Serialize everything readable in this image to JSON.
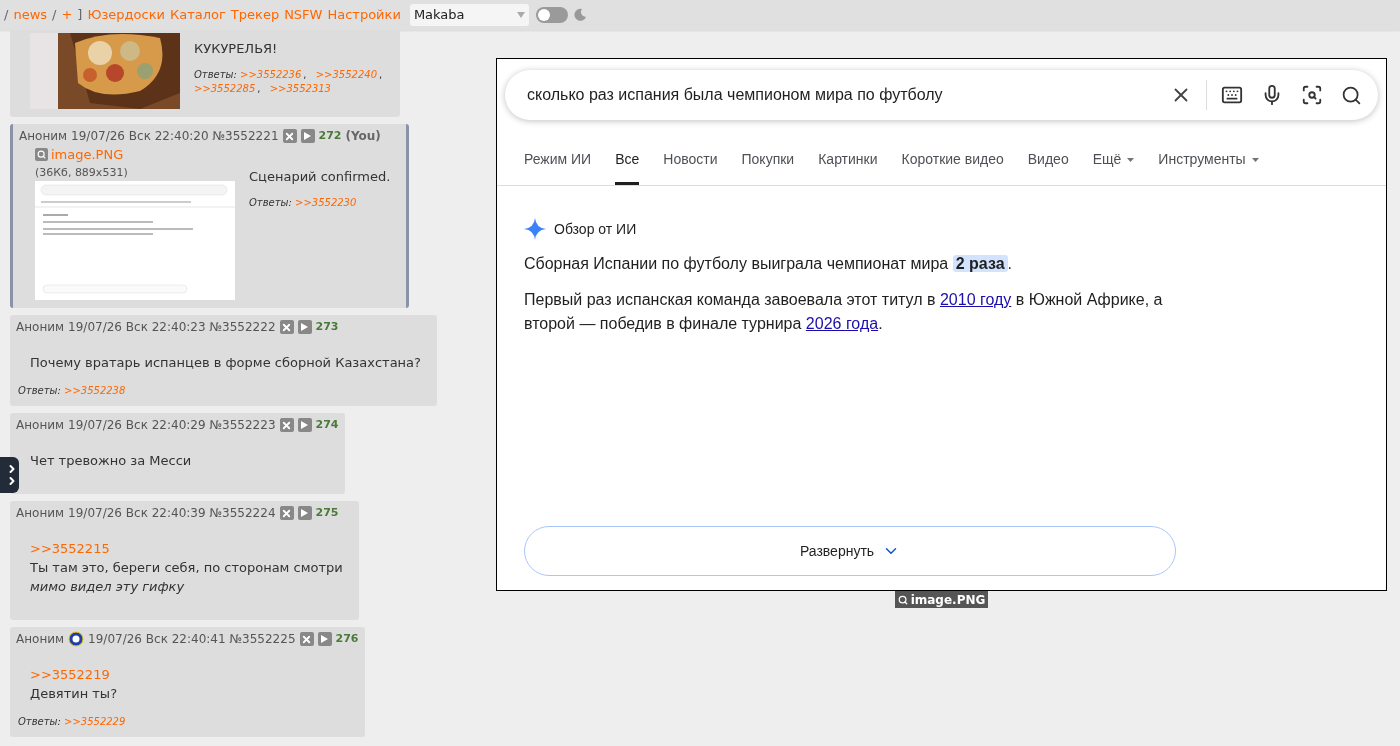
{
  "top_bar": {
    "nav": [
      {
        "kind": "sep",
        "text": "/"
      },
      {
        "kind": "link",
        "text": "news"
      },
      {
        "kind": "sep",
        "text": "/"
      },
      {
        "kind": "link",
        "text": "+"
      },
      {
        "kind": "sep",
        "text": "]"
      },
      {
        "kind": "link",
        "text": "Юзердоски"
      },
      {
        "kind": "link",
        "text": "Каталог"
      },
      {
        "kind": "link",
        "text": "Трекер"
      },
      {
        "kind": "link",
        "text": "NSFW"
      },
      {
        "kind": "link",
        "text": "Настройки"
      }
    ],
    "style_select": {
      "value": "Makaba"
    },
    "dark_mode": {
      "on": false
    }
  },
  "posts": [
    {
      "picture": {
        "kind": "picture"
      },
      "lines": [
        {
          "kind": "text",
          "text": "КУКУРЕЛЬЯ!"
        }
      ],
      "replies_label": "Ответы:",
      "replies": [
        ">>3552236",
        ">>3552240",
        ">>3552285",
        ">>3552313"
      ],
      "reply_separator": ",",
      "highlighted": false
    },
    {
      "header": {
        "name": "Аноним",
        "badge": false,
        "date": "19/07/26 Вск 22:40:20",
        "number": "№3552221",
        "count": "272",
        "you": "(You)"
      },
      "file": {
        "name": "image.PNG",
        "info": "(36Кб, 889x531)"
      },
      "lines": [
        {
          "kind": "text",
          "text": "Сценарий confirmed."
        }
      ],
      "replies_label": "Ответы:",
      "replies": [
        ">>3552230"
      ],
      "highlighted": true
    },
    {
      "header": {
        "name": "Аноним",
        "badge": false,
        "date": "19/07/26 Вск 22:40:23",
        "number": "№3552222",
        "count": "273"
      },
      "lines": [
        {
          "kind": "text",
          "text": "Почему вратарь испанцев в форме сборной Казахстана?"
        }
      ],
      "replies_label": "Ответы:",
      "replies": [
        ">>3552238"
      ],
      "highlighted": false
    },
    {
      "header": {
        "name": "Аноним",
        "badge": false,
        "date": "19/07/26 Вск 22:40:29",
        "number": "№3552223",
        "count": "274"
      },
      "lines": [
        {
          "kind": "text",
          "text": "Чет тревожно за Месси"
        }
      ],
      "highlighted": false
    },
    {
      "header": {
        "name": "Аноним",
        "badge": false,
        "date": "19/07/26 Вск 22:40:39",
        "number": "№3552224",
        "count": "275"
      },
      "lines": [
        {
          "kind": "quote",
          "text": ">>3552215"
        },
        {
          "kind": "text",
          "text": "Ты там это, береги себя, по сторонам смотри"
        },
        {
          "kind": "italic",
          "text": "мимо видел эту гифку"
        }
      ],
      "highlighted": false
    },
    {
      "header": {
        "name": "Аноним",
        "badge": true,
        "date": "19/07/26 Вск 22:40:41",
        "number": "№3552225",
        "count": "276"
      },
      "lines": [
        {
          "kind": "quote",
          "text": ">>3552219"
        },
        {
          "kind": "text",
          "text": "Девятин ты?"
        }
      ],
      "replies_label": "Ответы:",
      "replies": [
        ">>3552229"
      ],
      "highlighted": false
    }
  ],
  "image_viewer": {
    "caption": "image.PNG",
    "screenshot": {
      "query": "сколько раз испания была чемпионом мира по футболу",
      "tabs": [
        {
          "label": "Режим ИИ",
          "selected": false,
          "dropdown": false
        },
        {
          "label": "Все",
          "selected": true,
          "dropdown": false
        },
        {
          "label": "Новости",
          "selected": false,
          "dropdown": false
        },
        {
          "label": "Покупки",
          "selected": false,
          "dropdown": false
        },
        {
          "label": "Картинки",
          "selected": false,
          "dropdown": false
        },
        {
          "label": "Короткие видео",
          "selected": false,
          "dropdown": false
        },
        {
          "label": "Видео",
          "selected": false,
          "dropdown": false
        },
        {
          "label": "Ещё",
          "selected": false,
          "dropdown": true
        },
        {
          "label": "Инструменты",
          "selected": false,
          "dropdown": true
        }
      ],
      "overview_title": "Обзор от ИИ",
      "paragraphs": [
        [
          {
            "kind": "plain",
            "text": "Сборная Испании по футболу выиграла чемпионат мира "
          },
          {
            "kind": "highlight",
            "text": "2 раза"
          },
          {
            "kind": "plain",
            "text": "."
          }
        ],
        [
          {
            "kind": "plain",
            "text": "Первый раз испанская команда завоевала этот титул в "
          },
          {
            "kind": "link",
            "text": "2010 году"
          },
          {
            "kind": "plain",
            "text": " в Южной Африке, а второй — победив в финале турнира "
          },
          {
            "kind": "link",
            "text": "2026 года"
          },
          {
            "kind": "plain",
            "text": "."
          }
        ]
      ],
      "expand_button": "Развернуть"
    }
  }
}
